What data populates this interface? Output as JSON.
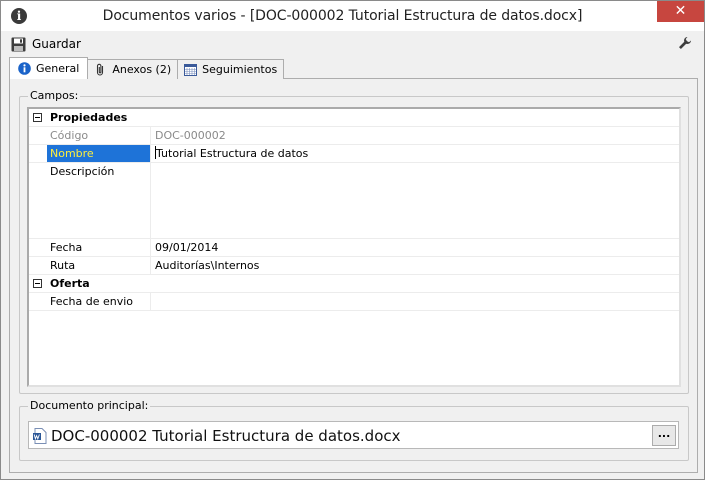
{
  "window": {
    "title": "Documentos varios - [DOC-000002 Tutorial Estructura de datos.docx]",
    "app_icon": "info-icon",
    "close_symbol": "✕"
  },
  "toolbar": {
    "save_label": "Guardar",
    "save_icon": "floppy-disk-icon",
    "settings_icon": "wrench-icon"
  },
  "tabs": [
    {
      "label": "General",
      "icon": "info-icon",
      "active": true
    },
    {
      "label": "Anexos (2)",
      "icon": "paperclip-icon",
      "active": false
    },
    {
      "label": "Seguimientos",
      "icon": "calendar-icon",
      "active": false
    }
  ],
  "fields_group": {
    "label": "Campos:",
    "categories": [
      {
        "name": "Propiedades",
        "rows": [
          {
            "name": "Código",
            "value": "DOC-000002",
            "readonly": true
          },
          {
            "name": "Nombre",
            "value": "Tutorial Estructura de datos",
            "selected": true
          },
          {
            "name": "Descripción",
            "value": ""
          },
          {
            "name": "Fecha",
            "value": "09/01/2014"
          },
          {
            "name": "Ruta",
            "value": "Auditorías\\Internos"
          }
        ]
      },
      {
        "name": "Oferta",
        "rows": [
          {
            "name": "Fecha de envio",
            "value": ""
          }
        ]
      }
    ]
  },
  "main_document": {
    "label": "Documento principal:",
    "file_name": "DOC-000002 Tutorial Estructura de datos.docx",
    "file_icon": "word-document-icon",
    "browse_label": "..."
  },
  "colors": {
    "selection_bg": "#1e73d8",
    "selection_text": "#ffef3c",
    "close_button": "#c7463f",
    "readonly_text": "#8a8a8a"
  }
}
